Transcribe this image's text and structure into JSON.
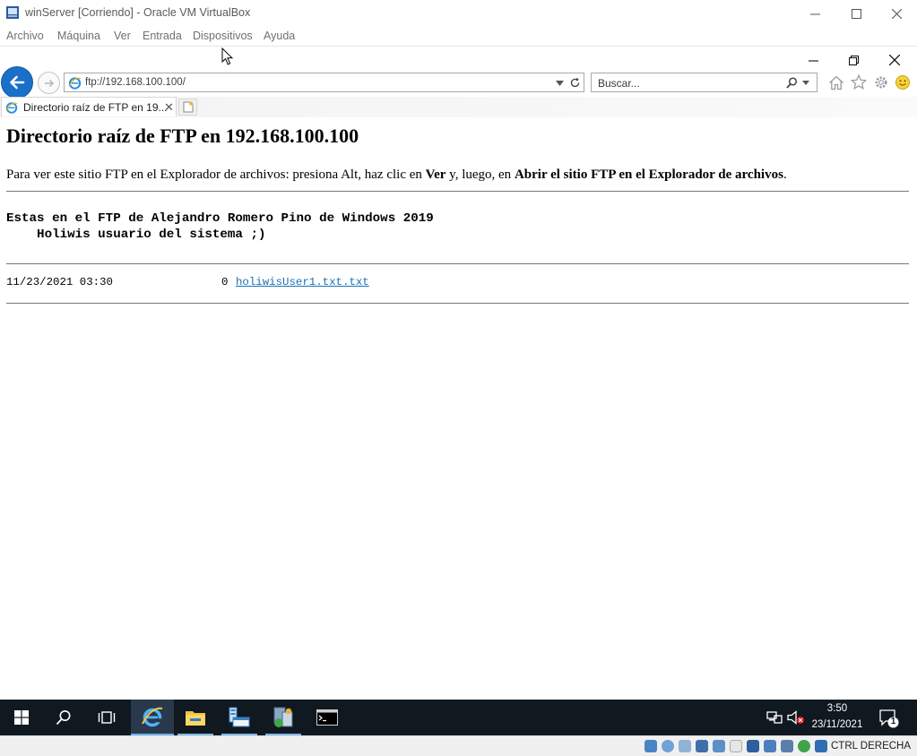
{
  "vbox": {
    "title": "winServer [Corriendo] - Oracle VM VirtualBox",
    "menu": [
      "Archivo",
      "Máquina",
      "Ver",
      "Entrada",
      "Dispositivos",
      "Ayuda"
    ],
    "host_key": "CTRL DERECHA"
  },
  "browser": {
    "address": "ftp://192.168.100.100/",
    "search_placeholder": "Buscar...",
    "tab_title": "Directorio raíz de FTP en 19..."
  },
  "page": {
    "heading": "Directorio raíz de FTP en 192.168.100.100",
    "instructions": {
      "before": "Para ver este sitio FTP en el Explorador de archivos: presiona Alt, haz clic en ",
      "bold1": "Ver",
      "middle": " y, luego, en ",
      "bold2": "Abrir el sitio FTP en el Explorador de archivos",
      "after": "."
    },
    "banner_line1": "Estas en el FTP de Alejandro Romero Pino de Windows 2019",
    "banner_line2": "    Holiwis usuario del sistema ;)",
    "files": [
      {
        "datetime": "11/23/2021 03:30",
        "size": "0",
        "name": "holiwisUser1.txt.txt"
      }
    ]
  },
  "taskbar": {
    "time": "3:50",
    "date": "23/11/2021",
    "notification_count": "1"
  },
  "colors": {
    "accent_blue": "#1a6fc9",
    "taskbar_bg": "#101820",
    "link": "#1a6fb5"
  }
}
